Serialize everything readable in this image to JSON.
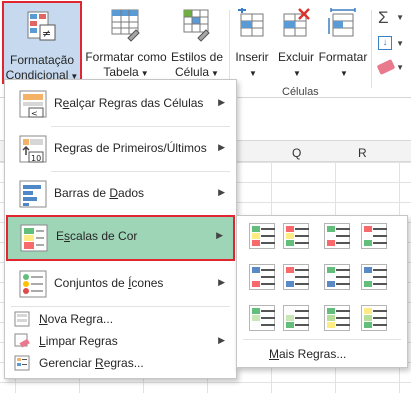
{
  "ribbon": {
    "conditional_formatting": {
      "line1": "Formatação",
      "line2": "Condicional"
    },
    "format_table": {
      "line1": "Formatar como",
      "line2": "Tabela"
    },
    "cell_styles": {
      "line1": "Estilos de",
      "line2": "Célula"
    },
    "insert": {
      "line1": "Inserir"
    },
    "delete": {
      "line1": "Excluir"
    },
    "format": {
      "line1": "Formatar"
    },
    "cells_group": "Células"
  },
  "sheet": {
    "columns": [
      "Q",
      "R"
    ]
  },
  "menu": {
    "items": [
      {
        "pre": "R",
        "u": "e",
        "post": "alçar Regras das Células"
      },
      {
        "pre": "Regras de Primeiros/Últimos",
        "u": "",
        "post": ""
      },
      {
        "pre": "Barras de ",
        "u": "D",
        "post": "ados"
      },
      {
        "pre": "E",
        "u": "s",
        "post": "calas de Cor"
      },
      {
        "pre": "Conjuntos de ",
        "u": "Í",
        "post": "cones"
      }
    ],
    "small_items": [
      {
        "pre": "",
        "u": "N",
        "post": "ova Regra..."
      },
      {
        "pre": "",
        "u": "L",
        "post": "impar Regras"
      },
      {
        "pre": "Gerenciar ",
        "u": "R",
        "post": "egras..."
      }
    ]
  },
  "submenu": {
    "more_pre": "",
    "more_u": "M",
    "more_post": "ais Regras..."
  },
  "colors": {
    "accent_red": "#e0272f",
    "highlight_green": "#9fd5b7",
    "ribbon_selected": "#c6d9ee"
  }
}
